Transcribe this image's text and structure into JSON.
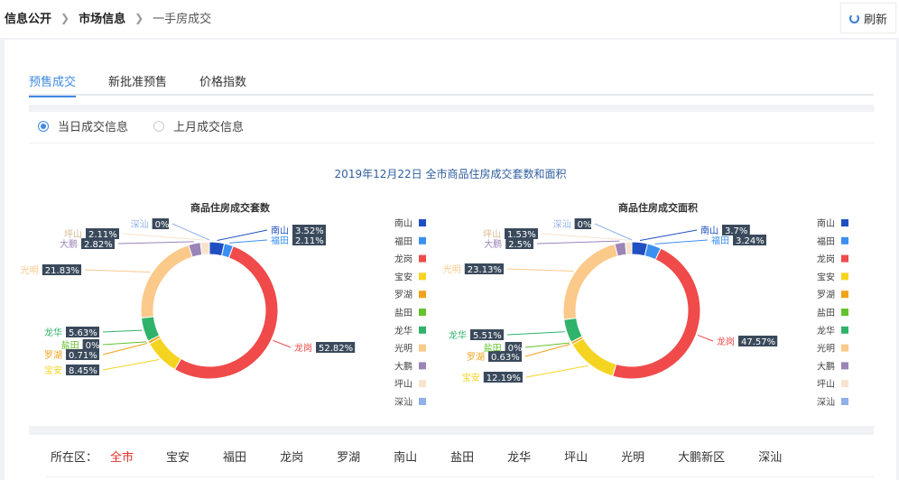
{
  "breadcrumb": {
    "items": [
      "信息公开",
      "市场信息",
      "一手房成交"
    ]
  },
  "refresh_label": "刷新",
  "tabs": [
    "预售成交",
    "新批准预售",
    "价格指数"
  ],
  "radios": {
    "today": "当日成交信息",
    "last_month": "上月成交信息"
  },
  "main_title": "2019年12月22日 全市商品住房成交套数和面积",
  "district_filter": {
    "label": "所在区：",
    "options": [
      "全市",
      "宝安",
      "福田",
      "龙岗",
      "罗湖",
      "南山",
      "盐田",
      "龙华",
      "坪山",
      "光明",
      "大鹏新区",
      "深汕"
    ]
  },
  "chart_data": [
    {
      "type": "pie",
      "title": "商品住房成交套数",
      "categories": [
        "南山",
        "福田",
        "龙岗",
        "宝安",
        "罗湖",
        "盐田",
        "龙华",
        "光明",
        "大鹏",
        "坪山",
        "深汕"
      ],
      "labels": [
        "3.52%",
        "2.11%",
        "52.82%",
        "8.45%",
        "0.71%",
        "0%",
        "5.63%",
        "21.83%",
        "2.82%",
        "2.11%",
        "0%"
      ],
      "values": [
        3.52,
        2.11,
        52.82,
        8.45,
        0.71,
        0,
        5.63,
        21.83,
        2.82,
        2.11,
        0
      ],
      "colors": [
        "#1f4fc0",
        "#3b8ff0",
        "#f04a4a",
        "#f5d421",
        "#f0a31a",
        "#63c22e",
        "#2fb36a",
        "#fbc98a",
        "#9b84b8",
        "#f7e3cc",
        "#8fb0e8"
      ],
      "legend_position": "right"
    },
    {
      "type": "pie",
      "title": "商品住房成交面积",
      "categories": [
        "南山",
        "福田",
        "龙岗",
        "宝安",
        "罗湖",
        "盐田",
        "龙华",
        "光明",
        "大鹏",
        "坪山",
        "深汕"
      ],
      "labels": [
        "3.7%",
        "3.24%",
        "47.57%",
        "12.19%",
        "0.63%",
        "0%",
        "5.51%",
        "23.13%",
        "2.5%",
        "1.53%",
        "0%"
      ],
      "values": [
        3.7,
        3.24,
        47.57,
        12.19,
        0.63,
        0,
        5.51,
        23.13,
        2.5,
        1.53,
        0
      ],
      "colors": [
        "#1f4fc0",
        "#3b8ff0",
        "#f04a4a",
        "#f5d421",
        "#f0a31a",
        "#63c22e",
        "#2fb36a",
        "#fbc98a",
        "#9b84b8",
        "#f7e3cc",
        "#8fb0e8"
      ],
      "legend_position": "right"
    }
  ]
}
